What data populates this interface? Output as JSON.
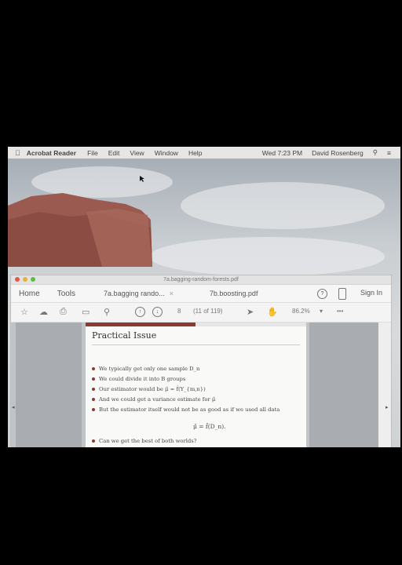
{
  "menubar": {
    "app": "Acrobat Reader",
    "items": [
      "File",
      "Edit",
      "View",
      "Window",
      "Help"
    ],
    "clock": "Wed 7:23 PM",
    "user": "David Rosenberg"
  },
  "window": {
    "title": "7a.bagging-random-forests.pdf",
    "tabs": {
      "home": "Home",
      "tools": "Tools",
      "doc1": "7a.bagging rando...",
      "doc2": "7b.boosting.pdf",
      "signin": "Sign In"
    },
    "toolbar": {
      "page_current": "8",
      "page_info": "(11 of 119)",
      "zoom": "86.2%"
    }
  },
  "slide": {
    "title": "Practical Issue",
    "bullets": [
      "We typically get only one sample D_n",
      "We could divide it into B groups",
      "Our estimator would be μ̂ = f̂(Y_{m,n})",
      "And we could get a variance estimate for μ̂",
      "But the estimator itself would not be as good as if we used all data"
    ],
    "formula": "μ̂ = f̂(D_n).",
    "last_bullet": "Can we get the best of both worlds?"
  },
  "colors": {
    "accent": "#8c3a2f",
    "close": "#e0584f",
    "minimize": "#e4b33c",
    "zoom": "#5fbe46"
  }
}
